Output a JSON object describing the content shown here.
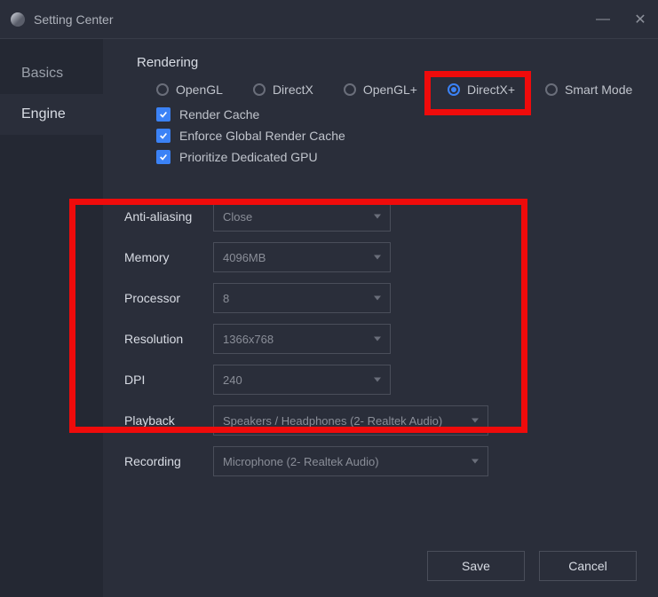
{
  "titlebar": {
    "title": "Setting Center"
  },
  "sidebar": {
    "tabs": [
      {
        "label": "Basics"
      },
      {
        "label": "Engine"
      }
    ]
  },
  "section": {
    "title": "Rendering"
  },
  "radios": [
    {
      "label": "OpenGL"
    },
    {
      "label": "DirectX"
    },
    {
      "label": "OpenGL+"
    },
    {
      "label": "DirectX+"
    },
    {
      "label": "Smart Mode"
    }
  ],
  "checks": [
    {
      "label": "Render Cache"
    },
    {
      "label": "Enforce Global Render Cache"
    },
    {
      "label": "Prioritize Dedicated GPU"
    }
  ],
  "fields": {
    "antialias": {
      "label": "Anti-aliasing",
      "value": "Close"
    },
    "memory": {
      "label": "Memory",
      "value": "4096MB"
    },
    "processor": {
      "label": "Processor",
      "value": "8"
    },
    "resolution": {
      "label": "Resolution",
      "value": "1366x768"
    },
    "dpi": {
      "label": "DPI",
      "value": "240"
    },
    "playback": {
      "label": "Playback",
      "value": "Speakers / Headphones (2- Realtek Audio)"
    },
    "recording": {
      "label": "Recording",
      "value": "Microphone (2- Realtek Audio)"
    }
  },
  "footer": {
    "save": "Save",
    "cancel": "Cancel"
  }
}
